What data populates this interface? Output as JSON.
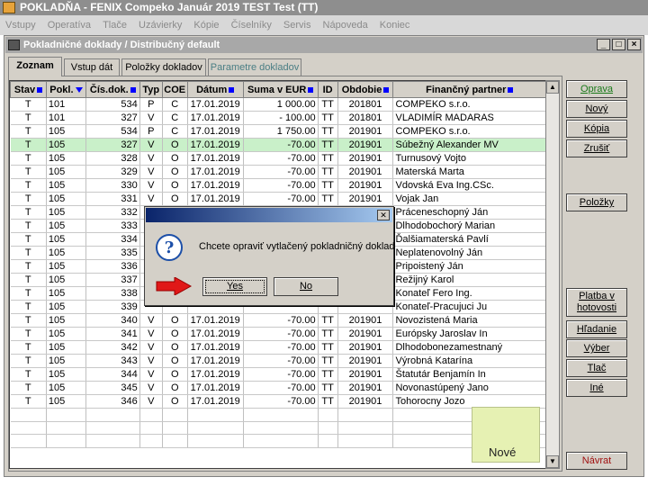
{
  "titlebar": {
    "title": "POKLADŇA - FENIX Compeko   Január 2019   TEST Test  (TT)"
  },
  "menu": {
    "items": [
      "Vstupy",
      "Operatíva",
      "Tlače",
      "Uzávierky",
      "Kópie",
      "Číselníky",
      "Servis",
      "Nápoveda",
      "Koniec"
    ]
  },
  "window": {
    "title": "Pokladničné doklady / Distribučný default",
    "controls": [
      "_",
      "□",
      "×"
    ]
  },
  "tabs": [
    "Zoznam",
    "Vstup dát",
    "Položky dokladov",
    "Parametre dokladov"
  ],
  "table": {
    "columns": [
      "Stav",
      "Pokl.",
      "Čís.dok.",
      "Typ",
      "COE",
      "Dátum",
      "Suma v EUR",
      "ID",
      "Obdobie",
      "Finančný partner"
    ],
    "rows": [
      [
        "T",
        "101",
        "534",
        "P",
        "C",
        "17.01.2019",
        "1 000.00",
        "TT",
        "201801",
        "COMPEKO s.r.o."
      ],
      [
        "T",
        "101",
        "327",
        "V",
        "C",
        "17.01.2019",
        "- 100.00",
        "TT",
        "201801",
        "VLADIMÍR MADARAS"
      ],
      [
        "T",
        "105",
        "534",
        "P",
        "C",
        "17.01.2019",
        "1 750.00",
        "TT",
        "201901",
        "COMPEKO s.r.o."
      ],
      [
        "T",
        "105",
        "327",
        "V",
        "O",
        "17.01.2019",
        "-70.00",
        "TT",
        "201901",
        "Súbežný Alexander MV"
      ],
      [
        "T",
        "105",
        "328",
        "V",
        "O",
        "17.01.2019",
        "-70.00",
        "TT",
        "201901",
        "Turnusový Vojto"
      ],
      [
        "T",
        "105",
        "329",
        "V",
        "O",
        "17.01.2019",
        "-70.00",
        "TT",
        "201901",
        "Materská Marta"
      ],
      [
        "T",
        "105",
        "330",
        "V",
        "O",
        "17.01.2019",
        "-70.00",
        "TT",
        "201901",
        "Vdovská Eva Ing.CSc."
      ],
      [
        "T",
        "105",
        "331",
        "V",
        "O",
        "17.01.2019",
        "-70.00",
        "TT",
        "201901",
        "Vojak Jan"
      ],
      [
        "T",
        "105",
        "332",
        "",
        "",
        "",
        "",
        "",
        "",
        "Práceneschopný Ján"
      ],
      [
        "T",
        "105",
        "333",
        "",
        "",
        "",
        "",
        "",
        "",
        "Dlhodobochorý Marian"
      ],
      [
        "T",
        "105",
        "334",
        "",
        "",
        "",
        "",
        "",
        "",
        "Ďalšiamaterská Pavlí"
      ],
      [
        "T",
        "105",
        "335",
        "",
        "",
        "",
        "",
        "",
        "",
        "Neplatenovolný Ján"
      ],
      [
        "T",
        "105",
        "336",
        "",
        "",
        "",
        "",
        "",
        "",
        "Pripoistený Ján"
      ],
      [
        "T",
        "105",
        "337",
        "",
        "",
        "",
        "",
        "",
        "",
        "Režijný Karol"
      ],
      [
        "T",
        "105",
        "338",
        "",
        "",
        "",
        "",
        "",
        "",
        "Konateľ Fero Ing."
      ],
      [
        "T",
        "105",
        "339",
        "",
        "",
        "",
        "",
        "",
        "",
        "Konateľ-Pracujuci Ju"
      ],
      [
        "T",
        "105",
        "340",
        "V",
        "O",
        "17.01.2019",
        "-70.00",
        "TT",
        "201901",
        "Novozistená Maria"
      ],
      [
        "T",
        "105",
        "341",
        "V",
        "O",
        "17.01.2019",
        "-70.00",
        "TT",
        "201901",
        "Európsky Jaroslav In"
      ],
      [
        "T",
        "105",
        "342",
        "V",
        "O",
        "17.01.2019",
        "-70.00",
        "TT",
        "201901",
        "Dlhodobonezamestnaný"
      ],
      [
        "T",
        "105",
        "343",
        "V",
        "O",
        "17.01.2019",
        "-70.00",
        "TT",
        "201901",
        "Výrobná Katarína"
      ],
      [
        "T",
        "105",
        "344",
        "V",
        "O",
        "17.01.2019",
        "-70.00",
        "TT",
        "201901",
        "Štatutár Benjamín In"
      ],
      [
        "T",
        "105",
        "345",
        "V",
        "O",
        "17.01.2019",
        "-70.00",
        "TT",
        "201901",
        "Novonastúpený Jano"
      ],
      [
        "T",
        "105",
        "346",
        "V",
        "O",
        "17.01.2019",
        "-70.00",
        "TT",
        "201901",
        "Tohorocny Jozo"
      ]
    ],
    "selected_row": 3,
    "highlight_color": "#c9f0c9"
  },
  "side_buttons": {
    "oprava": "Oprava",
    "novy": "Nový",
    "kopia": "Kópia",
    "zrusit": "Zrušiť",
    "polozky": "Položky",
    "platba_line1": "Platba v",
    "platba_line2": "hotovosti",
    "hradanie": "Hľadanie",
    "vyber": "Výber",
    "tlac": "Tlač",
    "ine": "Iné",
    "navrat": "Návrat"
  },
  "note": {
    "label": "Nové"
  },
  "dialog": {
    "message": "Chcete opraviť vytlačený pokladničný doklad",
    "yes": "Yes",
    "no": "No",
    "icon": "question-icon"
  }
}
